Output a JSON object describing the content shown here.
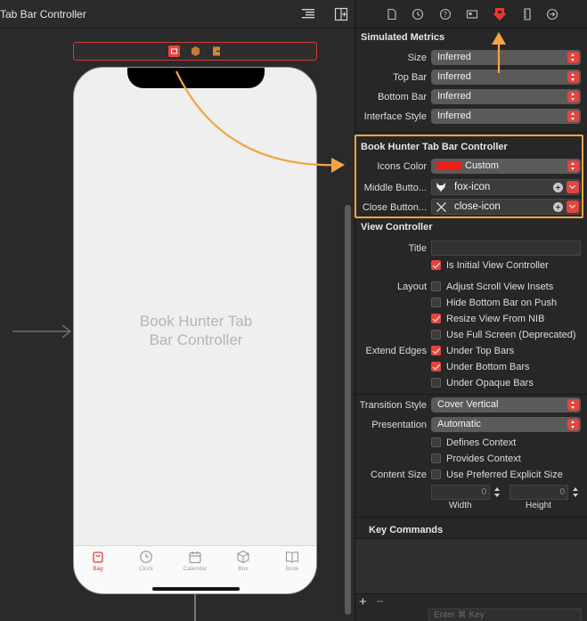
{
  "canvas": {
    "title": "Tab Bar Controller",
    "scene_title_line1": "Book Hunter Tab",
    "scene_title_line2": "Bar Controller",
    "tabs": [
      {
        "label": "Bag",
        "icon": "bag-icon",
        "active": true
      },
      {
        "label": "Clock",
        "icon": "clock-icon",
        "active": false
      },
      {
        "label": "Calendar",
        "icon": "calendar-icon",
        "active": false
      },
      {
        "label": "Box",
        "icon": "box-icon",
        "active": false
      },
      {
        "label": "Book",
        "icon": "book-icon",
        "active": false
      }
    ]
  },
  "inspector": {
    "tabs": [
      "file-icon",
      "history-icon",
      "help-icon",
      "identity-icon",
      "attributes-icon",
      "size-icon",
      "connections-icon"
    ],
    "active_tab": "attributes-icon",
    "simulated_metrics": {
      "header": "Simulated Metrics",
      "rows": [
        {
          "label": "Size",
          "value": "Inferred"
        },
        {
          "label": "Top Bar",
          "value": "Inferred"
        },
        {
          "label": "Bottom Bar",
          "value": "Inferred"
        },
        {
          "label": "Interface Style",
          "value": "Inferred"
        }
      ]
    },
    "book_hunter": {
      "header": "Book Hunter Tab Bar Controller",
      "icons_color_label": "Icons Color",
      "icons_color_value": "Custom",
      "icons_color_swatch": "#f21d16",
      "middle_button_label": "Middle Butto...",
      "middle_button_value": "fox-icon",
      "close_button_label": "Close Button...",
      "close_button_value": "close-icon"
    },
    "view_controller": {
      "header": "View Controller",
      "title_label": "Title",
      "title_value": "",
      "initial_vc_label": "Is Initial View Controller",
      "layout_label": "Layout",
      "layout_options": [
        {
          "label": "Adjust Scroll View Insets",
          "checked": false
        },
        {
          "label": "Hide Bottom Bar on Push",
          "checked": false
        },
        {
          "label": "Resize View From NIB",
          "checked": true
        },
        {
          "label": "Use Full Screen (Deprecated)",
          "checked": false
        }
      ],
      "extend_edges_label": "Extend Edges",
      "extend_edges_options": [
        {
          "label": "Under Top Bars",
          "checked": true
        },
        {
          "label": "Under Bottom Bars",
          "checked": true
        },
        {
          "label": "Under Opaque Bars",
          "checked": false
        }
      ],
      "transition_style_label": "Transition Style",
      "transition_style_value": "Cover Vertical",
      "presentation_label": "Presentation",
      "presentation_value": "Automatic",
      "defines_context_label": "Defines Context",
      "provides_context_label": "Provides Context",
      "content_size_label": "Content Size",
      "preferred_size_label": "Use Preferred Explicit Size",
      "width_value": "0",
      "height_value": "0",
      "width_label": "Width",
      "height_label": "Height"
    },
    "key_commands": {
      "header": "Key Commands",
      "add_label": "+",
      "remove_label": "−",
      "key_placeholder": "Enter ⌘ Key"
    }
  },
  "colors": {
    "accent": "#e0463f",
    "annotation": "#f4a543"
  }
}
